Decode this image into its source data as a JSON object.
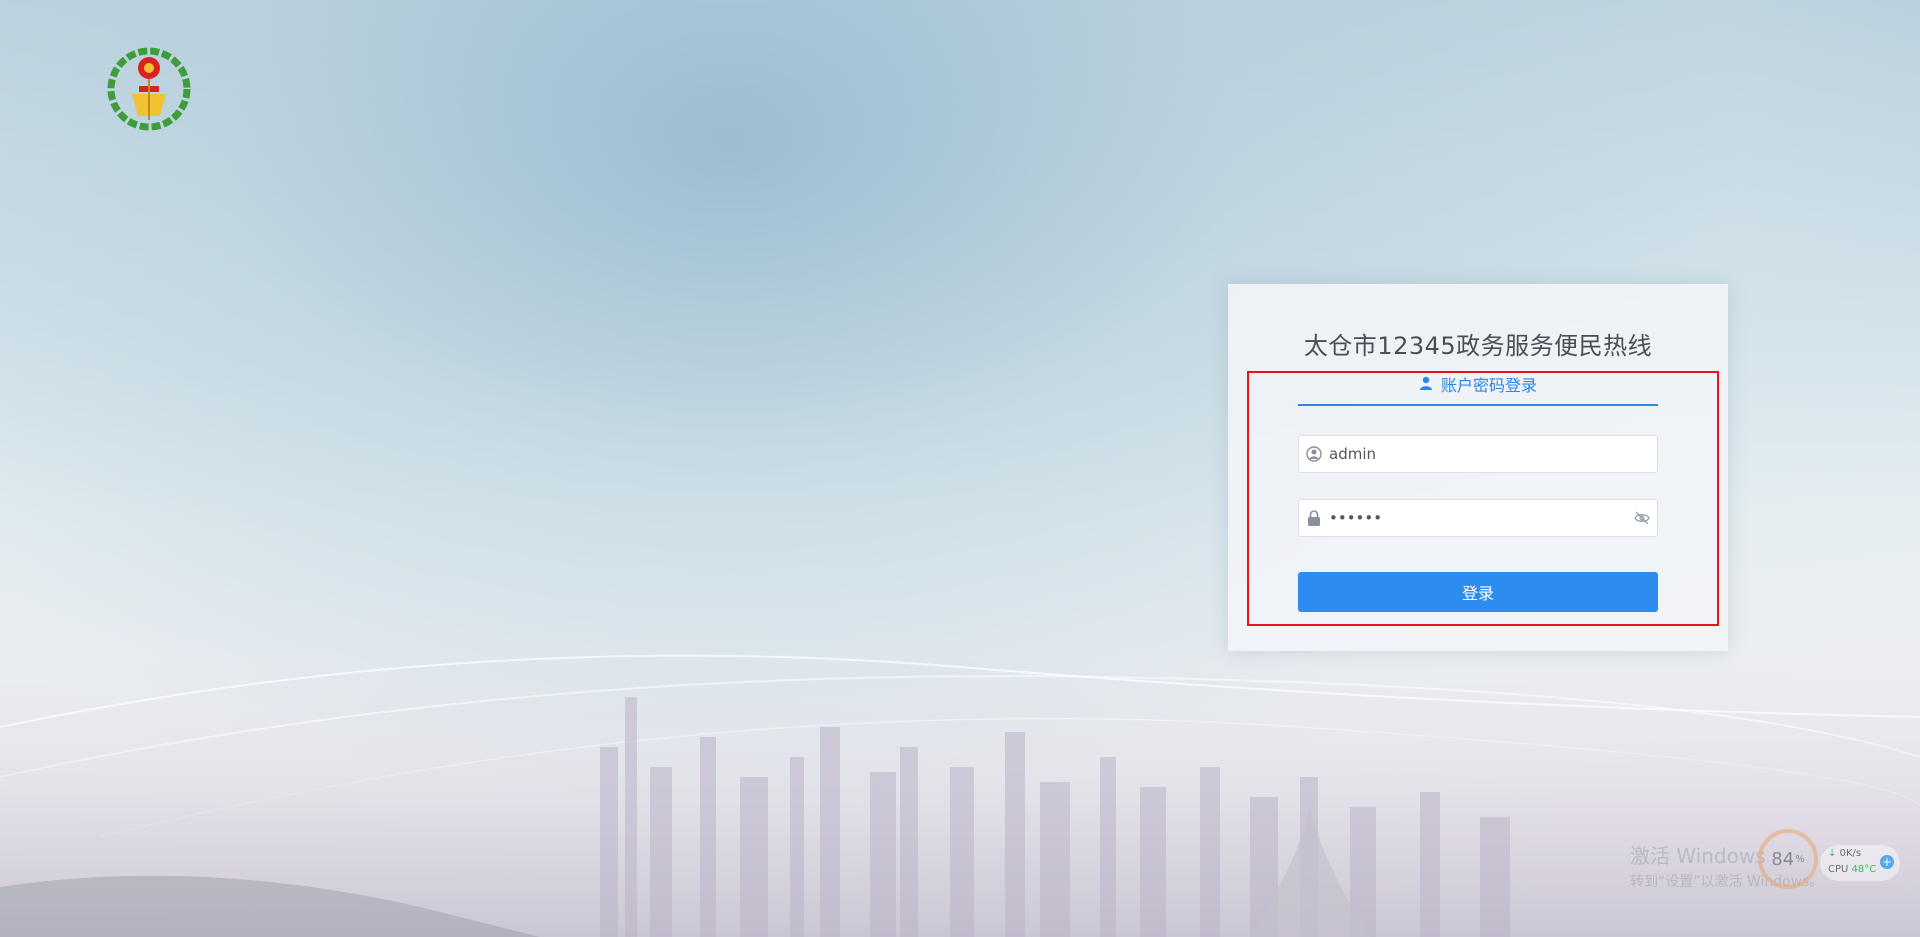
{
  "login": {
    "title": "太仓市12345政务服务便民热线",
    "tab_label": "账户密码登录",
    "username_value": "admin",
    "password_value": "••••••",
    "submit_label": "登录"
  },
  "system_overlay": {
    "watermark_line1": "激活 Windows",
    "watermark_line2": "转到“设置”以激活 Windows。",
    "monitor_percent": "84",
    "monitor_percent_unit": "%",
    "net_speed": "0K/s",
    "cpu_label": "CPU",
    "cpu_temp": "48°C",
    "plus": "+"
  },
  "icons": {
    "emblem": "national-emblem-icon",
    "tab": "user-icon",
    "username": "user-circle-icon",
    "password": "lock-icon",
    "visibility": "eye-off-icon"
  },
  "colors": {
    "accent": "#2d8cf0",
    "tab_underline": "#2d86e6",
    "highlight_outline": "#e8141a"
  }
}
